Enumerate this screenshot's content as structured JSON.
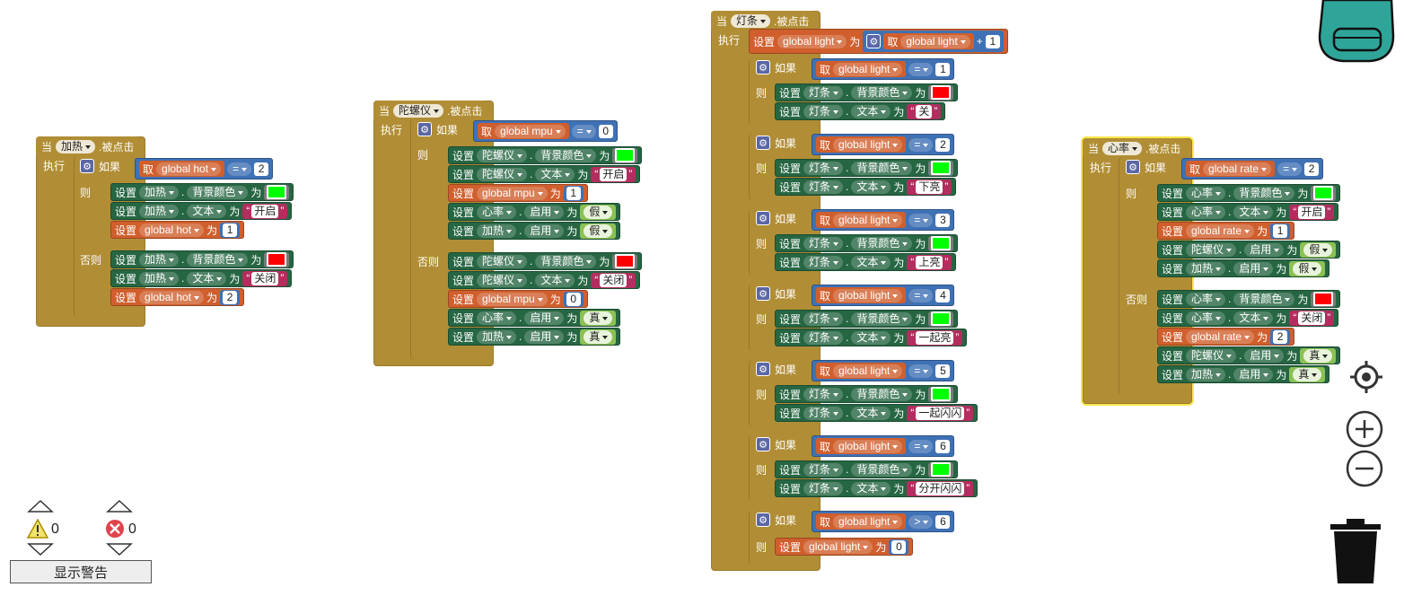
{
  "labels": {
    "when": "当",
    "clicked": ".被点击",
    "exec": "执行",
    "if": "如果",
    "then": "则",
    "else": "否则",
    "set": "设置",
    "get": "取",
    "to": "为",
    "quote": "“",
    "quote_end": "”",
    "dot": "."
  },
  "events": {
    "hot": {
      "component": "加热",
      "if_var": "global hot",
      "if_op": "=",
      "if_val": "2",
      "then": [
        {
          "kind": "prop",
          "comp": "加热",
          "prop": "背景颜色",
          "color": "#00FF00"
        },
        {
          "kind": "prop",
          "comp": "加热",
          "prop": "文本",
          "text": "开启"
        },
        {
          "kind": "var",
          "var": "global hot",
          "num": "1"
        }
      ],
      "else": [
        {
          "kind": "prop",
          "comp": "加热",
          "prop": "背景颜色",
          "color": "#FF0000"
        },
        {
          "kind": "prop",
          "comp": "加热",
          "prop": "文本",
          "text": "关闭"
        },
        {
          "kind": "var",
          "var": "global hot",
          "num": "2"
        }
      ]
    },
    "mpu": {
      "component": "陀螺仪",
      "if_var": "global mpu",
      "if_op": "=",
      "if_val": "0",
      "then": [
        {
          "kind": "prop",
          "comp": "陀螺仪",
          "prop": "背景颜色",
          "color": "#00FF00"
        },
        {
          "kind": "prop",
          "comp": "陀螺仪",
          "prop": "文本",
          "text": "开启"
        },
        {
          "kind": "var",
          "var": "global mpu",
          "num": "1"
        },
        {
          "kind": "bool",
          "comp": "心率",
          "prop": "启用",
          "bool": "假"
        },
        {
          "kind": "bool",
          "comp": "加热",
          "prop": "启用",
          "bool": "假"
        }
      ],
      "else": [
        {
          "kind": "prop",
          "comp": "陀螺仪",
          "prop": "背景颜色",
          "color": "#FF0000"
        },
        {
          "kind": "prop",
          "comp": "陀螺仪",
          "prop": "文本",
          "text": "关闭"
        },
        {
          "kind": "var",
          "var": "global mpu",
          "num": "0"
        },
        {
          "kind": "bool",
          "comp": "心率",
          "prop": "启用",
          "bool": "真"
        },
        {
          "kind": "bool",
          "comp": "加热",
          "prop": "启用",
          "bool": "真"
        }
      ]
    },
    "light": {
      "component": "灯条",
      "first": {
        "var": "global light",
        "get": "global light",
        "op": "+",
        "num": "1"
      },
      "ifs": [
        {
          "op": "=",
          "val": "1",
          "color": "#FF0000",
          "text": "关"
        },
        {
          "op": "=",
          "val": "2",
          "color": "#00FF00",
          "text": "下亮"
        },
        {
          "op": "=",
          "val": "3",
          "color": "#00FF00",
          "text": "上亮"
        },
        {
          "op": "=",
          "val": "4",
          "color": "#00FF00",
          "text": "一起亮"
        },
        {
          "op": "=",
          "val": "5",
          "color": "#00FF00",
          "text": "一起闪闪"
        },
        {
          "op": "=",
          "val": "6",
          "color": "#00FF00",
          "text": "分开闪闪"
        }
      ],
      "last": {
        "op": ">",
        "val": "6",
        "set_var": "global light",
        "set_num": "0"
      },
      "bg_prop": "背景颜色",
      "text_prop": "文本",
      "var": "global light"
    },
    "rate": {
      "component": "心率",
      "if_var": "global rate",
      "if_op": "=",
      "if_val": "2",
      "then": [
        {
          "kind": "prop",
          "comp": "心率",
          "prop": "背景颜色",
          "color": "#00FF00"
        },
        {
          "kind": "prop",
          "comp": "心率",
          "prop": "文本",
          "text": "开启"
        },
        {
          "kind": "var",
          "var": "global rate",
          "num": "1"
        },
        {
          "kind": "bool",
          "comp": "陀螺仪",
          "prop": "启用",
          "bool": "假"
        },
        {
          "kind": "bool",
          "comp": "加热",
          "prop": "启用",
          "bool": "假"
        }
      ],
      "else": [
        {
          "kind": "prop",
          "comp": "心率",
          "prop": "背景颜色",
          "color": "#FF0000"
        },
        {
          "kind": "prop",
          "comp": "心率",
          "prop": "文本",
          "text": "关闭"
        },
        {
          "kind": "var",
          "var": "global rate",
          "num": "2"
        },
        {
          "kind": "bool",
          "comp": "陀螺仪",
          "prop": "启用",
          "bool": "真"
        },
        {
          "kind": "bool",
          "comp": "加热",
          "prop": "启用",
          "bool": "真"
        }
      ]
    }
  },
  "warnings": {
    "count": "0",
    "errors": "0",
    "button": "显示警告"
  },
  "icons": [
    "backpack-icon",
    "target-icon",
    "zoom-in-icon",
    "zoom-out-icon",
    "trash-icon",
    "warning-icon",
    "error-icon"
  ]
}
